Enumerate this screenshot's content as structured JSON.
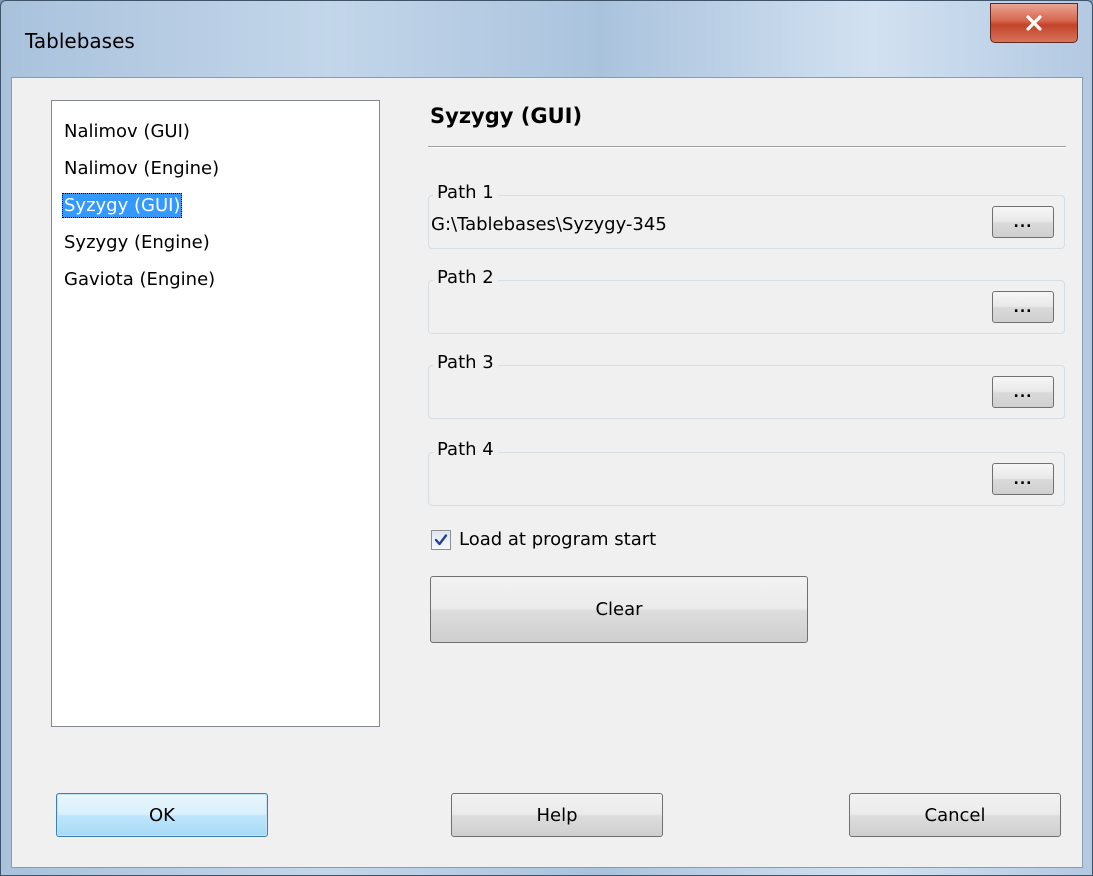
{
  "window": {
    "title": "Tablebases",
    "close_glyph": "✕"
  },
  "sidebar": {
    "items": [
      {
        "label": "Nalimov (GUI)",
        "selected": false
      },
      {
        "label": "Nalimov (Engine)",
        "selected": false
      },
      {
        "label": "Syzygy (GUI)",
        "selected": true
      },
      {
        "label": "Syzygy (Engine)",
        "selected": false
      },
      {
        "label": "Gaviota (Engine)",
        "selected": false
      }
    ]
  },
  "panel": {
    "title": "Syzygy (GUI)",
    "paths": [
      {
        "label": "Path 1",
        "value": "G:\\Tablebases\\Syzygy-345",
        "browse_label": "..."
      },
      {
        "label": "Path 2",
        "value": "",
        "browse_label": "..."
      },
      {
        "label": "Path 3",
        "value": "",
        "browse_label": "..."
      },
      {
        "label": "Path 4",
        "value": "",
        "browse_label": "..."
      }
    ],
    "load_at_start": {
      "label": "Load at program start",
      "checked": true
    },
    "clear_label": "Clear"
  },
  "footer": {
    "ok_label": "OK",
    "help_label": "Help",
    "cancel_label": "Cancel"
  },
  "colors": {
    "selection": "#3399ff",
    "close_button": "#c2432a",
    "default_button_border": "#3c7fb1"
  }
}
